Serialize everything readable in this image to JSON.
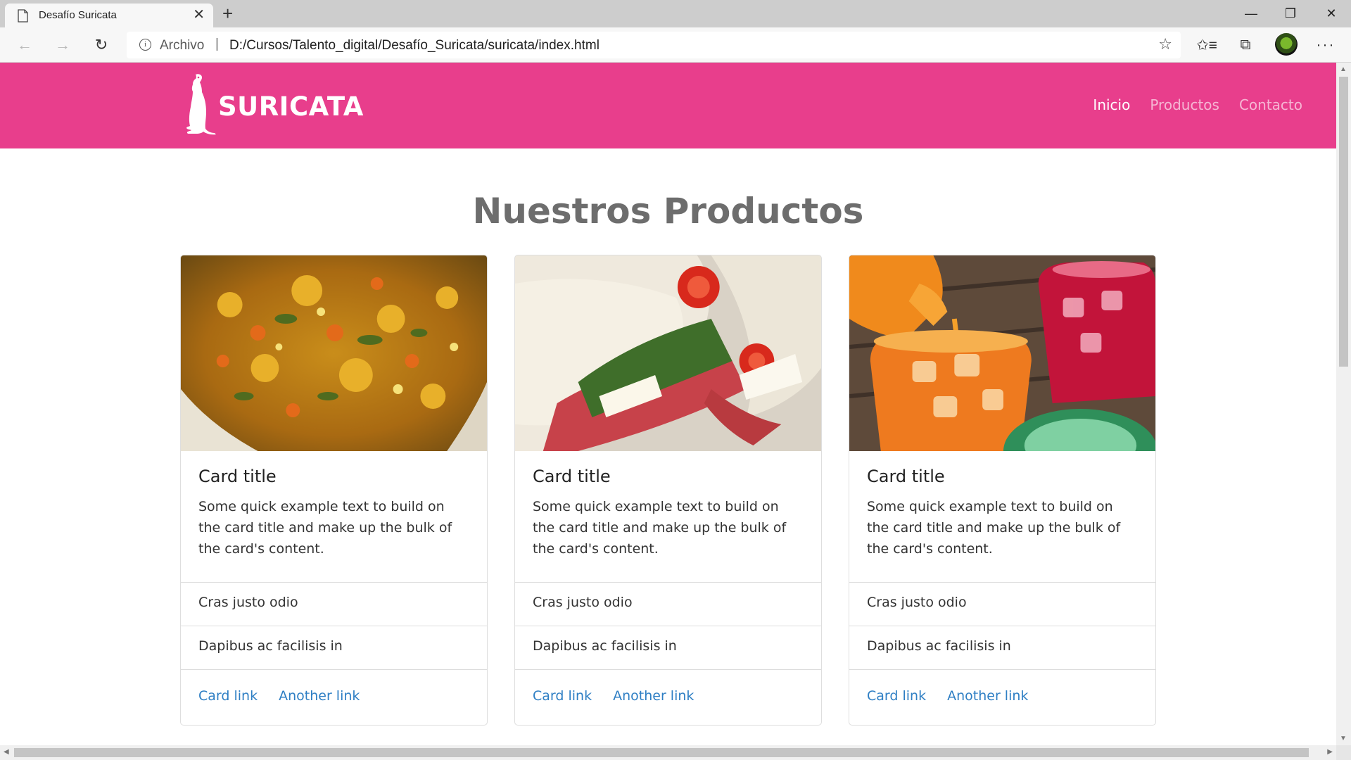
{
  "browser": {
    "tab_title": "Desafío Suricata",
    "tab_close": "✕",
    "new_tab": "+",
    "window_min": "—",
    "window_max": "❐",
    "window_close": "✕",
    "back": "←",
    "forward": "→",
    "reload": "↻",
    "address_scheme": "Archivo",
    "address_separator": "|",
    "address_url": "D:/Cursos/Talento_digital/Desafío_Suricata/suricata/index.html",
    "favorite_star": "☆",
    "favorites": "✩≡",
    "collections": "⧉",
    "more": "···",
    "icons": [
      "page-icon",
      "info-icon",
      "star-icon",
      "favorites-icon",
      "collections-icon",
      "profile-icon",
      "more-icon"
    ]
  },
  "site": {
    "brand": "SURICATA",
    "brand_color": "#e83e8c",
    "nav": [
      {
        "label": "Inicio",
        "active": true
      },
      {
        "label": "Productos",
        "active": false
      },
      {
        "label": "Contacto",
        "active": false
      }
    ]
  },
  "main": {
    "title": "Nuestros Productos",
    "cards": [
      {
        "image": "vegetable-stew-image",
        "title": "Card title",
        "text": "Some quick example text to build on the card title and make up the bulk of the card's content.",
        "items": [
          "Cras justo odio",
          "Dapibus ac facilisis in"
        ],
        "links": [
          "Card link",
          "Another link"
        ]
      },
      {
        "image": "sandwich-image",
        "title": "Card title",
        "text": "Some quick example text to build on the card title and make up the bulk of the card's content.",
        "items": [
          "Cras justo odio",
          "Dapibus ac facilisis in"
        ],
        "links": [
          "Card link",
          "Another link"
        ]
      },
      {
        "image": "iced-drinks-image",
        "title": "Card title",
        "text": "Some quick example text to build on the card title and make up the bulk of the card's content.",
        "items": [
          "Cras justo odio",
          "Dapibus ac facilisis in"
        ],
        "links": [
          "Card link",
          "Another link"
        ]
      }
    ]
  },
  "colors": {
    "link": "#2f7fc4",
    "title_gray": "#6d6d6d"
  }
}
